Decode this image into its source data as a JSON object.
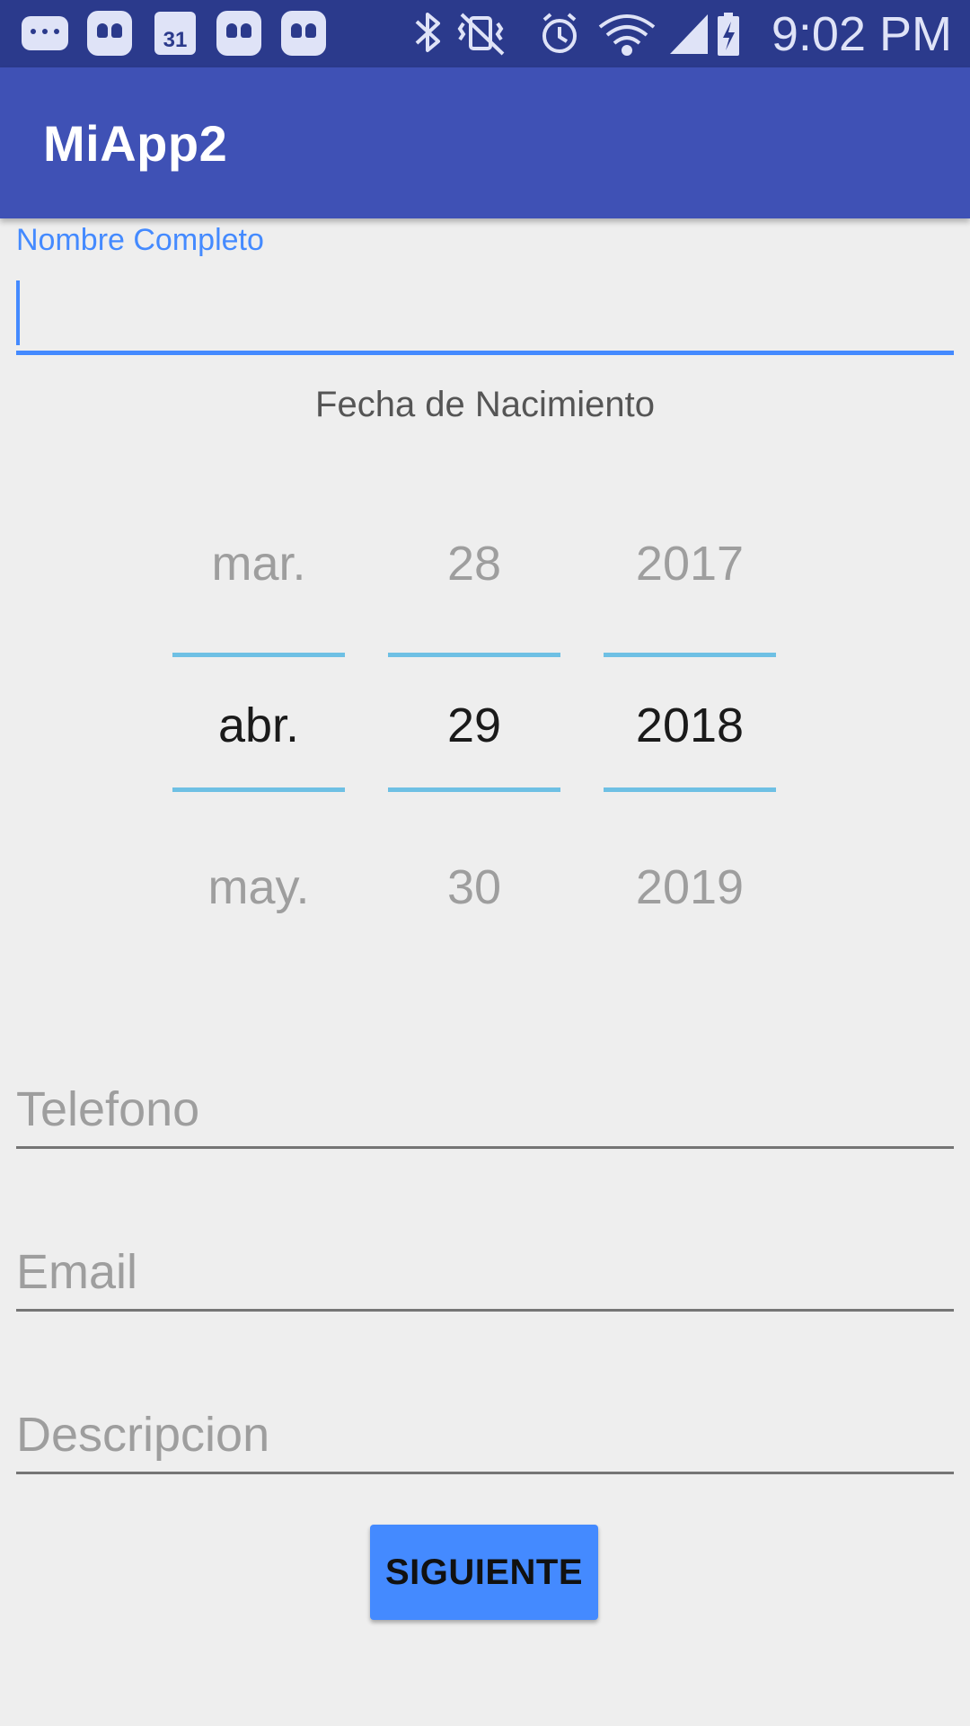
{
  "status_bar": {
    "time": "9:02 PM",
    "calendar_day": "31",
    "icons": [
      "message-icon",
      "hangouts-icon",
      "calendar-icon",
      "hangouts-icon",
      "hangouts-icon",
      "bluetooth-icon",
      "vibrate-icon",
      "alarm-icon",
      "wifi-icon",
      "signal-icon",
      "battery-charging-icon"
    ]
  },
  "app_bar": {
    "title": "MiApp2"
  },
  "form": {
    "name_label": "Nombre Completo",
    "name_value": "",
    "birth_label": "Fecha de Nacimiento",
    "date_picker": {
      "month": {
        "prev": "mar.",
        "current": "abr.",
        "next": "may."
      },
      "day": {
        "prev": "28",
        "current": "29",
        "next": "30"
      },
      "year": {
        "prev": "2017",
        "current": "2018",
        "next": "2019"
      }
    },
    "phone_placeholder": "Telefono",
    "email_placeholder": "Email",
    "description_placeholder": "Descripcion",
    "next_button": "SIGUIENTE"
  },
  "colors": {
    "status_bar": "#2b3a8c",
    "app_bar": "#3f51b5",
    "accent": "#448aff",
    "picker_divider": "#6ec0e4",
    "background": "#eeeeee"
  }
}
